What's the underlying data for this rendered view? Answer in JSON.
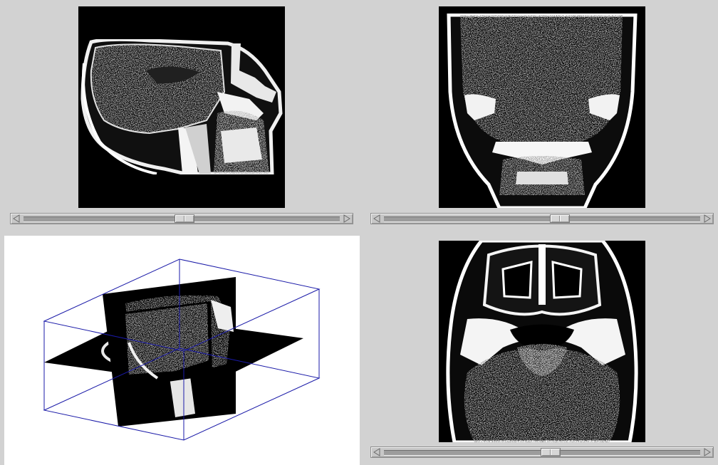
{
  "viewer": {
    "background_color": "#d2d2d2",
    "box_color": "#1a1aa8",
    "panels": {
      "sagittal": {
        "name": "sagittal-view",
        "slider_value": 0.51
      },
      "coronal": {
        "name": "coronal-view",
        "slider_value": 0.56
      },
      "axial": {
        "name": "axial-view",
        "slider_value": 0.53
      },
      "volume": {
        "name": "3d-volume-view"
      }
    },
    "icons": {
      "scroll_left": "triangle-left-icon",
      "scroll_right": "triangle-right-icon"
    }
  }
}
